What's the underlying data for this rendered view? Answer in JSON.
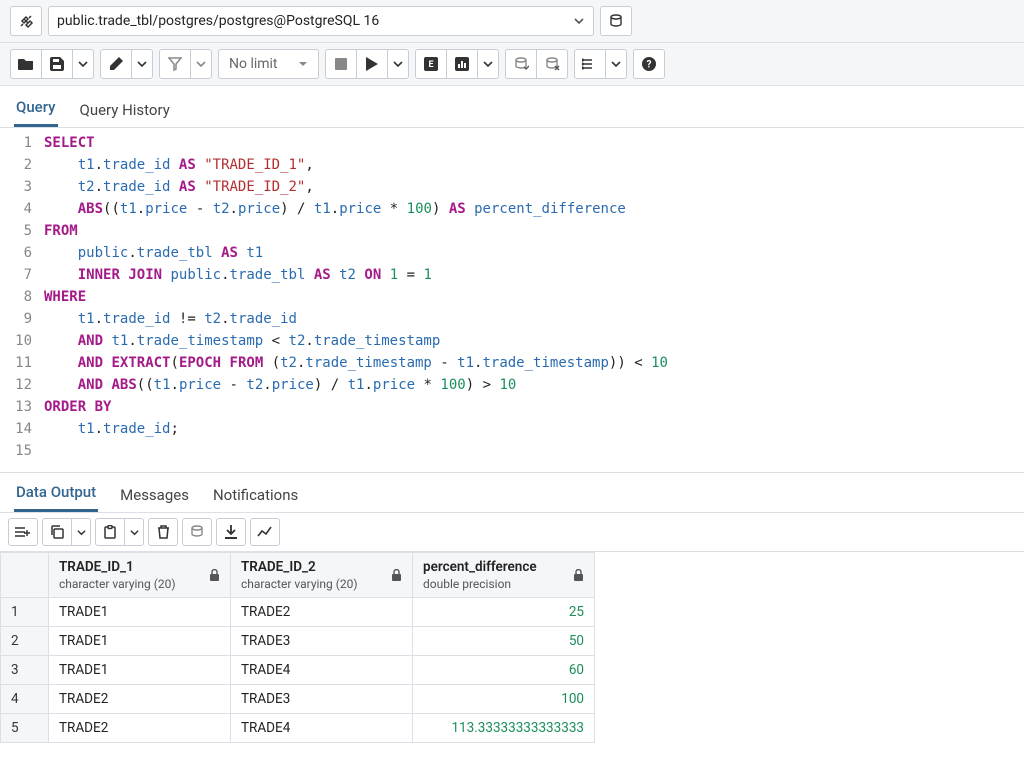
{
  "connection": {
    "label": "public.trade_tbl/postgres/postgres@PostgreSQL 16"
  },
  "toolbar": {
    "limit_label": "No limit"
  },
  "tabs": {
    "query": "Query",
    "history": "Query History"
  },
  "sql": {
    "lines": [
      "SELECT",
      "    t1.trade_id AS \"TRADE_ID_1\",",
      "    t2.trade_id AS \"TRADE_ID_2\",",
      "    ABS((t1.price - t2.price) / t1.price * 100) AS percent_difference",
      "FROM",
      "    public.trade_tbl AS t1",
      "    INNER JOIN public.trade_tbl AS t2 ON 1 = 1",
      "WHERE",
      "    t1.trade_id != t2.trade_id",
      "    AND t1.trade_timestamp < t2.trade_timestamp",
      "    AND EXTRACT(EPOCH FROM (t2.trade_timestamp - t1.trade_timestamp)) < 10",
      "    AND ABS((t1.price - t2.price) / t1.price * 100) > 10",
      "ORDER BY",
      "    t1.trade_id;",
      ""
    ]
  },
  "result_tabs": {
    "data": "Data Output",
    "messages": "Messages",
    "notifications": "Notifications"
  },
  "columns": [
    {
      "name": "TRADE_ID_1",
      "type": "character varying (20)",
      "align": "left"
    },
    {
      "name": "TRADE_ID_2",
      "type": "character varying (20)",
      "align": "left"
    },
    {
      "name": "percent_difference",
      "type": "double precision",
      "align": "right"
    }
  ],
  "rows": [
    [
      "TRADE1",
      "TRADE2",
      "25"
    ],
    [
      "TRADE1",
      "TRADE3",
      "50"
    ],
    [
      "TRADE1",
      "TRADE4",
      "60"
    ],
    [
      "TRADE2",
      "TRADE3",
      "100"
    ],
    [
      "TRADE2",
      "TRADE4",
      "113.33333333333333"
    ]
  ]
}
